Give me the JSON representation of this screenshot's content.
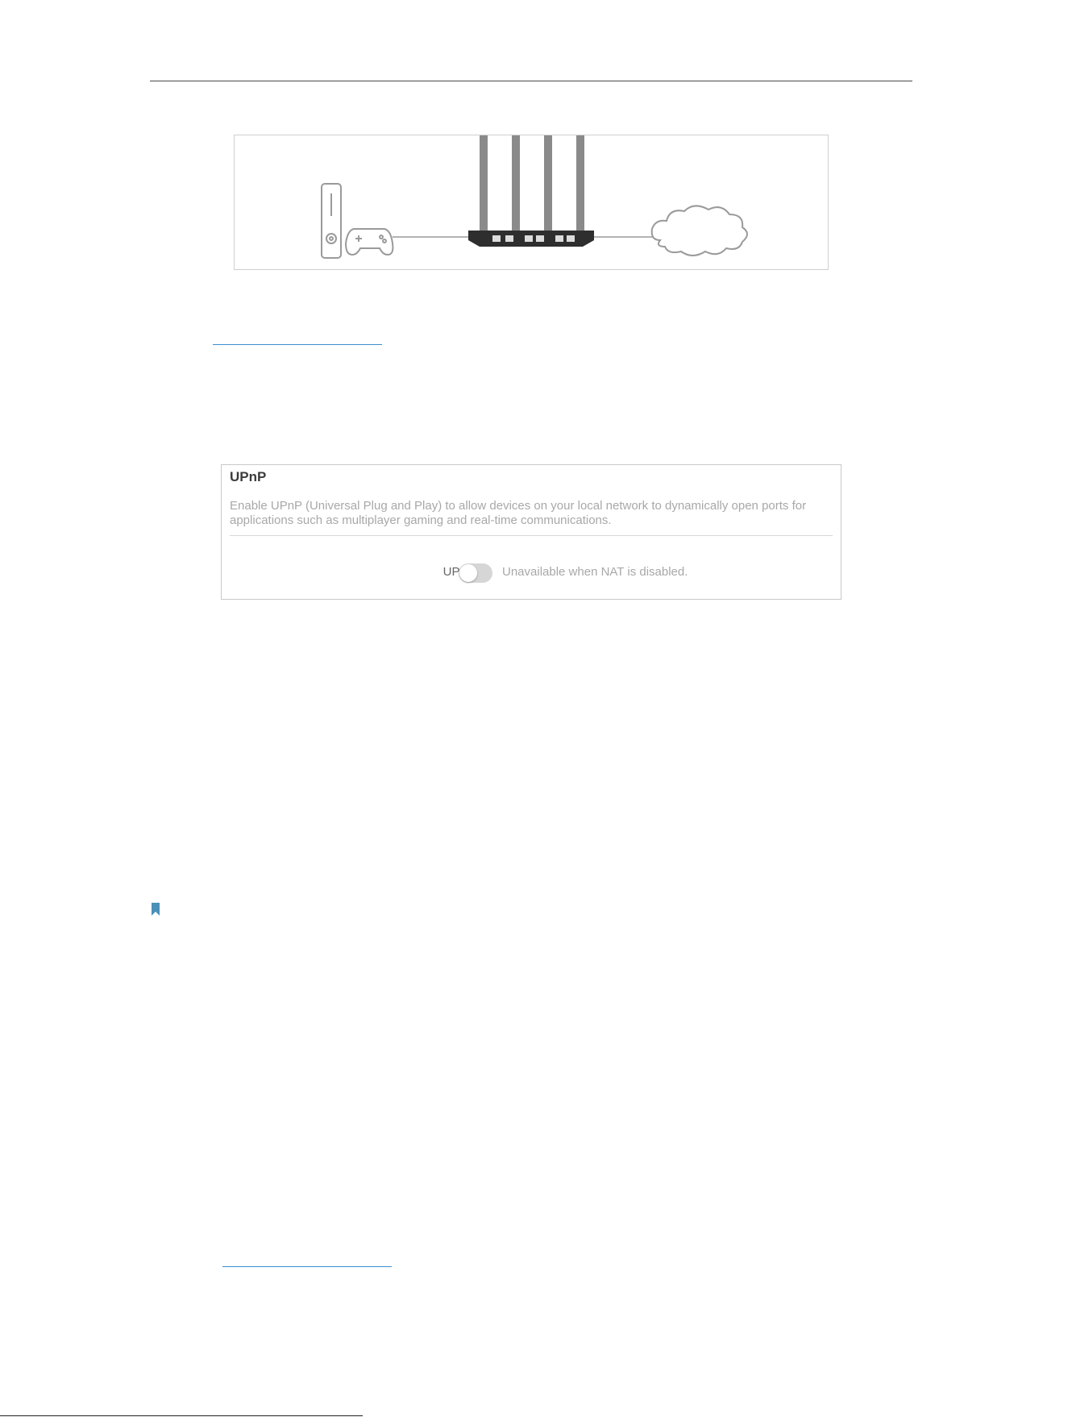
{
  "diagram": {
    "devices": [
      "game-console-icon",
      "gamepad-icon",
      "router-icon",
      "cloud-icon"
    ]
  },
  "upnp_panel": {
    "title": "UPnP",
    "description": "Enable UPnP (Universal Plug and Play) to allow devices on your local network to dynamically open ports for applications such as multiplayer gaming and real-time communications.",
    "toggle_label": "UPnP:",
    "toggle_state": "off",
    "toggle_hint": "Unavailable when NAT is disabled."
  },
  "note": {
    "icon": "bookmark-icon",
    "color": "#4a90b8"
  },
  "footer": {
    "text": ""
  },
  "colors": {
    "link": "#3a8fd0",
    "panel_border": "#c8c8c8",
    "muted_text": "#a8a8a8"
  }
}
